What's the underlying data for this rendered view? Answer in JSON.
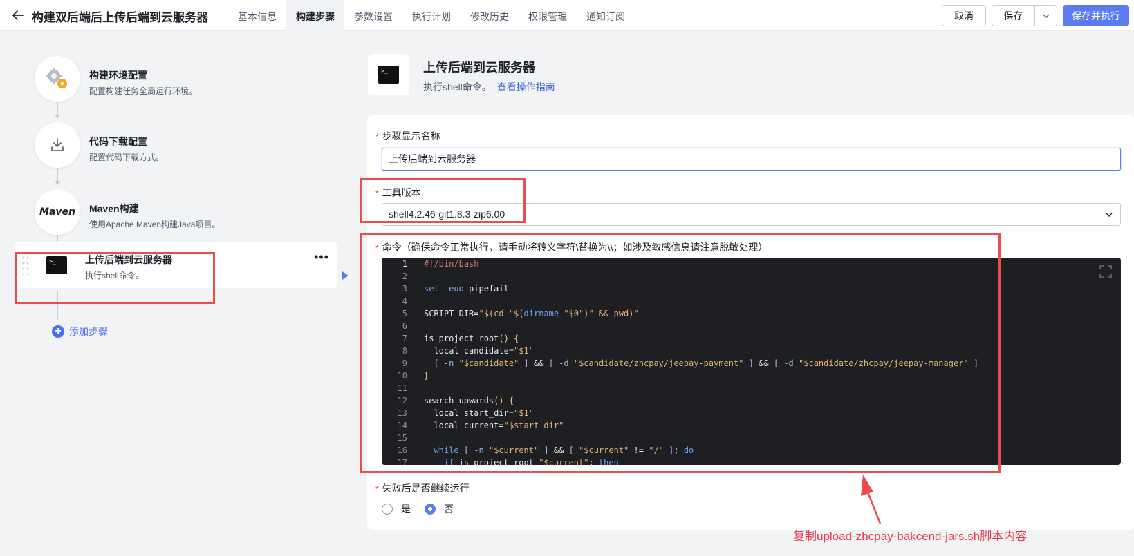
{
  "header": {
    "title": "构建双后端后上传后端到云服务器",
    "tabs": [
      {
        "label": "基本信息"
      },
      {
        "label": "构建步骤"
      },
      {
        "label": "参数设置"
      },
      {
        "label": "执行计划"
      },
      {
        "label": "修改历史"
      },
      {
        "label": "权限管理"
      },
      {
        "label": "通知订阅"
      }
    ],
    "active_tab": "构建步骤",
    "cancel_label": "取消",
    "save_label": "保存",
    "save_run_label": "保存并执行"
  },
  "steps": [
    {
      "title": "构建环境配置",
      "desc": "配置构建任务全局运行环境。",
      "icon": "gears-icon"
    },
    {
      "title": "代码下载配置",
      "desc": "配置代码下载方式。",
      "icon": "download-icon"
    },
    {
      "title": "Maven构建",
      "desc": "使用Apache Maven构建Java项目。",
      "icon": "maven-logo",
      "logo_text": "Maven"
    },
    {
      "title": "上传后端到云服务器",
      "desc": "执行shell命令。",
      "icon": "terminal-icon"
    }
  ],
  "add_step_label": "添加步骤",
  "detail": {
    "title": "上传后端到云服务器",
    "desc": "执行shell命令。",
    "guide_link": "查看操作指南",
    "terminal_glyph": ">_"
  },
  "form": {
    "name_label": "步骤显示名称",
    "name_value": "上传后端到云服务器",
    "tool_label": "工具版本",
    "tool_value": "shell4.2.46-git1.8.3-zip6.00",
    "command_label": "命令（确保命令正常执行，请手动将转义字符\\替换为\\\\；如涉及敏感信息请注意脱敏处理）",
    "continue_label": "失败后是否继续运行",
    "option_yes": "是",
    "option_no": "否",
    "continue_selected": "否"
  },
  "code_lines": [
    "#!/bin/bash",
    "",
    "set -euo pipefail",
    "",
    "SCRIPT_DIR=\"$(cd \"$(dirname \"$0\")\" && pwd)\"",
    "",
    "is_project_root() {",
    "  local candidate=\"$1\"",
    "  [ -n \"$candidate\" ] && [ -d \"$candidate/zhcpay/jeepay-payment\" ] && [ -d \"$candidate/zhcpay/jeepay-manager\" ]",
    "}",
    "",
    "search_upwards() {",
    "  local start_dir=\"$1\"",
    "  local current=\"$start_dir\"",
    "",
    "  while [ -n \"$current\" ] && [ \"$current\" != \"/\" ]; do",
    "    if is_project_root \"$current\"; then"
  ],
  "annotation": {
    "text": "复制upload-zhcpay-bakcend-jars.sh脚本内容",
    "color": "#e8384f"
  },
  "colors": {
    "primary": "#5b7cf0",
    "highlight": "#ea4d4d"
  }
}
